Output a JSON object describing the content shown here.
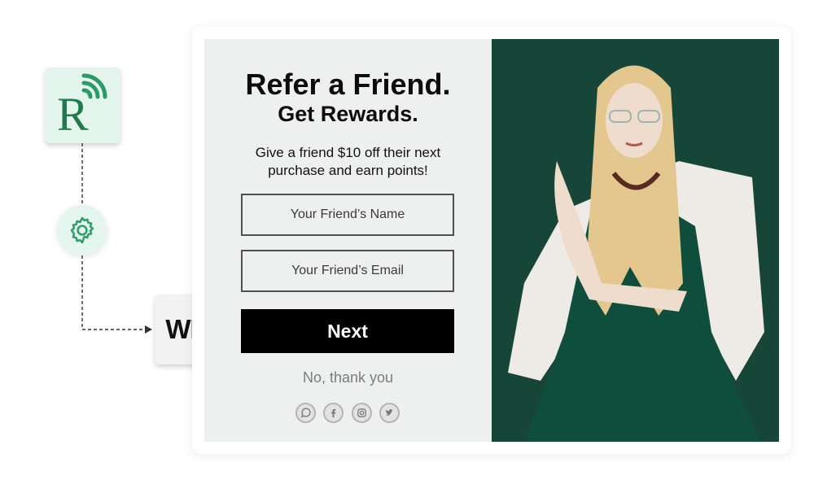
{
  "integration": {
    "brand_letter": "R",
    "platform_logo": "WIX",
    "icons": [
      "signal-icon",
      "gear-icon",
      "arrow-right-icon"
    ]
  },
  "popup": {
    "title": "Refer a Friend.",
    "subtitle": "Get Rewards.",
    "description_line1": "Give a friend $10 off their next",
    "description_line2": "purchase and earn points!",
    "name_placeholder": "Your Friend’s Name",
    "email_placeholder": "Your Friend’s Email",
    "next_label": "Next",
    "decline_label": "No, thank you",
    "social_icons": [
      "whatsapp-icon",
      "facebook-icon",
      "instagram-icon",
      "twitter-icon"
    ]
  },
  "colors": {
    "brand_green": "#1f7a4d",
    "gear_green": "#2f9e6a",
    "photo_bg": "#174538",
    "button_bg": "#000000"
  }
}
